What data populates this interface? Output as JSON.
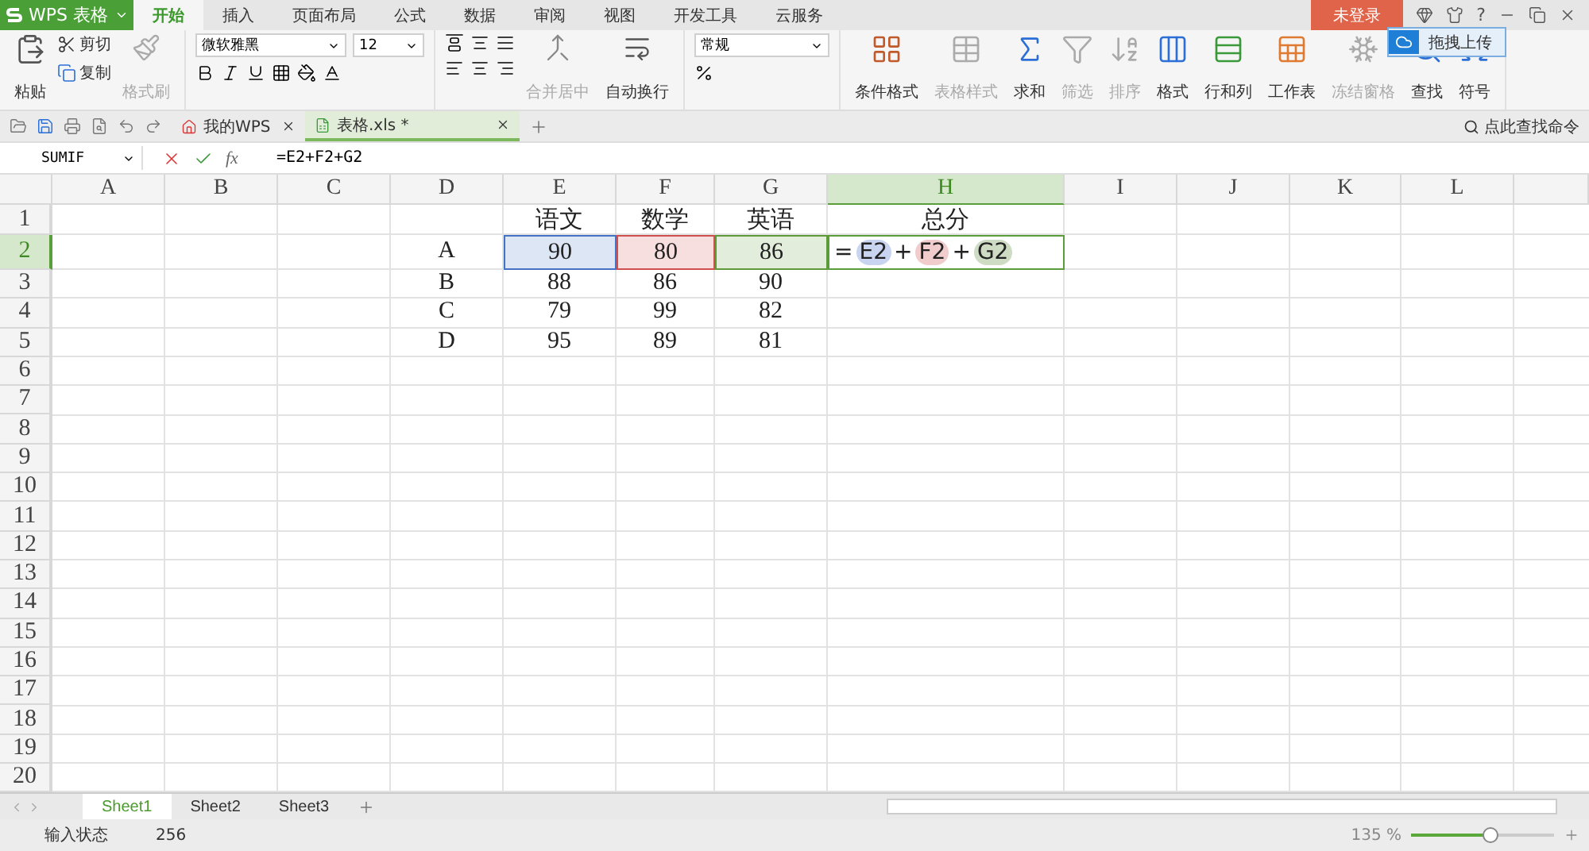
{
  "app": {
    "title": "WPS 表格"
  },
  "ribbon_tabs": [
    {
      "label": "开始",
      "selected": true
    },
    {
      "label": "插入",
      "selected": false
    },
    {
      "label": "页面布局",
      "selected": false
    },
    {
      "label": "公式",
      "selected": false
    },
    {
      "label": "数据",
      "selected": false
    },
    {
      "label": "审阅",
      "selected": false
    },
    {
      "label": "视图",
      "selected": false
    },
    {
      "label": "开发工具",
      "selected": false
    },
    {
      "label": "云服务",
      "selected": false
    }
  ],
  "login_button": "未登录",
  "help": "?",
  "upload_button": "拖拽上传",
  "clipboard": {
    "paste": "粘贴",
    "cut": "剪切",
    "copy": "复制",
    "format_painter": "格式刷",
    "format_painter_disabled": true
  },
  "font": {
    "name": "微软雅黑",
    "size": "12"
  },
  "alignment": {
    "merge": "合并居中",
    "merge_disabled": true,
    "wrap": "自动换行"
  },
  "number_format": "常规",
  "ribbon_buttons": [
    {
      "label": "条件格式",
      "kind": "conditional",
      "disabled": false
    },
    {
      "label": "表格样式",
      "kind": "style",
      "disabled": true
    },
    {
      "label": "求和",
      "kind": "sum",
      "disabled": false
    },
    {
      "label": "筛选",
      "kind": "filter",
      "disabled": true
    },
    {
      "label": "排序",
      "kind": "sort",
      "disabled": true
    },
    {
      "label": "格式",
      "kind": "format",
      "disabled": false
    },
    {
      "label": "行和列",
      "kind": "rows",
      "disabled": false
    },
    {
      "label": "工作表",
      "kind": "sheet",
      "disabled": false
    },
    {
      "label": "冻结窗格",
      "kind": "freeze",
      "disabled": true
    },
    {
      "label": "查找",
      "kind": "find",
      "disabled": false
    },
    {
      "label": "符号",
      "kind": "symbol",
      "disabled": false
    }
  ],
  "command_search": "点此查找命令",
  "doc_tabs": [
    {
      "label": "我的WPS",
      "kind": "home",
      "selected": false
    },
    {
      "label": "表格.xls *",
      "kind": "sheet",
      "selected": true
    }
  ],
  "name_box": "SUMIF",
  "function_label": "fx",
  "formula": "=E2+F2+G2",
  "columns": [
    {
      "label": "A",
      "selected": false
    },
    {
      "label": "B",
      "selected": false
    },
    {
      "label": "C",
      "selected": false
    },
    {
      "label": "D",
      "selected": false
    },
    {
      "label": "E",
      "selected": false
    },
    {
      "label": "F",
      "selected": false
    },
    {
      "label": "G",
      "selected": false
    },
    {
      "label": "H",
      "selected": true
    },
    {
      "label": "I",
      "selected": false
    },
    {
      "label": "J",
      "selected": false
    },
    {
      "label": "K",
      "selected": false
    },
    {
      "label": "L",
      "selected": false
    }
  ],
  "rows": [
    {
      "label": "1",
      "selected": false
    },
    {
      "label": "2",
      "selected": true
    },
    {
      "label": "3",
      "selected": false
    },
    {
      "label": "4",
      "selected": false
    },
    {
      "label": "5",
      "selected": false
    },
    {
      "label": "6",
      "selected": false
    },
    {
      "label": "7",
      "selected": false
    },
    {
      "label": "8",
      "selected": false
    },
    {
      "label": "9",
      "selected": false
    },
    {
      "label": "10",
      "selected": false
    },
    {
      "label": "11",
      "selected": false
    },
    {
      "label": "12",
      "selected": false
    },
    {
      "label": "13",
      "selected": false
    },
    {
      "label": "14",
      "selected": false
    },
    {
      "label": "15",
      "selected": false
    },
    {
      "label": "16",
      "selected": false
    },
    {
      "label": "17",
      "selected": false
    },
    {
      "label": "18",
      "selected": false
    },
    {
      "label": "19",
      "selected": false
    },
    {
      "label": "20",
      "selected": false
    }
  ],
  "table": {
    "headers": [
      "语文",
      "数学",
      "英语",
      "总分"
    ],
    "rows": [
      {
        "label": "A",
        "values": [
          {
            "text": "90",
            "color": "#4472c4"
          },
          {
            "text": "80",
            "color": "#d05050"
          },
          {
            "text": "86",
            "color": "#5f9a3a"
          }
        ],
        "formula_parts": [
          {
            "kind": "operator",
            "text": "="
          },
          {
            "kind": "ref",
            "text": "E2",
            "color": "#c9d5f0"
          },
          {
            "kind": "operator",
            "text": "+"
          },
          {
            "kind": "ref",
            "text": "F2",
            "color": "#f1cccc"
          },
          {
            "kind": "operator",
            "text": "+"
          },
          {
            "kind": "ref",
            "text": "G2",
            "color": "#cddcc3"
          }
        ]
      },
      {
        "label": "B",
        "values": [
          {
            "text": "88"
          },
          {
            "text": "86"
          },
          {
            "text": "90"
          }
        ]
      },
      {
        "label": "C",
        "values": [
          {
            "text": "79"
          },
          {
            "text": "99"
          },
          {
            "text": "82"
          }
        ]
      },
      {
        "label": "D",
        "values": [
          {
            "text": "95"
          },
          {
            "text": "89"
          },
          {
            "text": "81"
          }
        ]
      }
    ]
  },
  "sheet_tabs": [
    {
      "label": "Sheet1",
      "selected": true
    },
    {
      "label": "Sheet2",
      "selected": false
    },
    {
      "label": "Sheet3",
      "selected": false
    }
  ],
  "status": {
    "mode": "输入状态",
    "count": "256",
    "zoom": "135 %",
    "zoom_level": {
      "level": 0.55
    }
  }
}
